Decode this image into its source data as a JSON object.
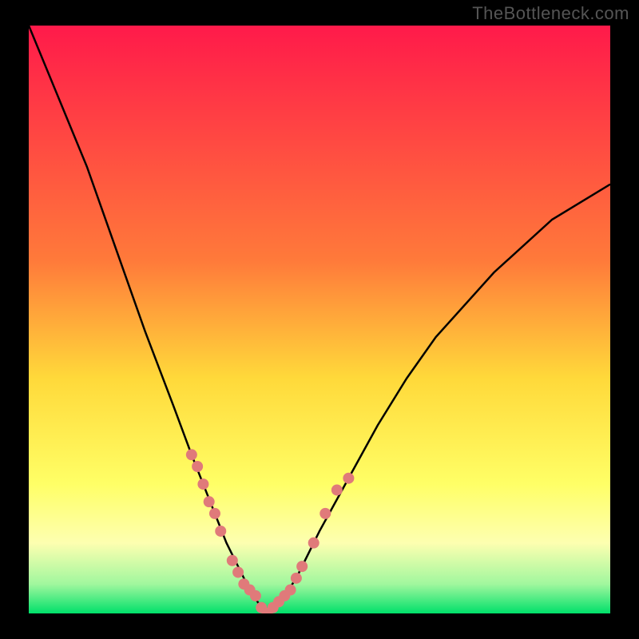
{
  "watermark": "TheBottleneck.com",
  "chart_data": {
    "type": "line",
    "title": "",
    "xlabel": "",
    "ylabel": "",
    "xlim": [
      0,
      100
    ],
    "ylim": [
      0,
      100
    ],
    "bottleneck_x": 41,
    "series": [
      {
        "name": "bottleneck-curve",
        "x": [
          0,
          5,
          10,
          15,
          20,
          25,
          28,
          30,
          32,
          34,
          36,
          38,
          40,
          41,
          42,
          44,
          46,
          48,
          50,
          55,
          60,
          65,
          70,
          80,
          90,
          100
        ],
        "y": [
          100,
          88,
          76,
          62,
          48,
          35,
          27,
          22,
          17,
          12,
          8,
          4,
          1,
          0,
          1,
          3,
          6,
          10,
          14,
          23,
          32,
          40,
          47,
          58,
          67,
          73
        ]
      }
    ],
    "markers": {
      "name": "data-points",
      "x": [
        28,
        29,
        30,
        31,
        32,
        33,
        35,
        36,
        37,
        38,
        39,
        40,
        41,
        42,
        43,
        44,
        45,
        46,
        47,
        49,
        51,
        53,
        55
      ],
      "y": [
        27,
        25,
        22,
        19,
        17,
        14,
        9,
        7,
        5,
        4,
        3,
        1,
        0,
        1,
        2,
        3,
        4,
        6,
        8,
        12,
        17,
        21,
        23
      ]
    },
    "background_gradient": {
      "stops": [
        {
          "offset": 0,
          "color": "#ff1a4a"
        },
        {
          "offset": 40,
          "color": "#ff7a3a"
        },
        {
          "offset": 60,
          "color": "#ffd93a"
        },
        {
          "offset": 78,
          "color": "#ffff66"
        },
        {
          "offset": 88,
          "color": "#fdffb0"
        },
        {
          "offset": 95,
          "color": "#a1f79e"
        },
        {
          "offset": 100,
          "color": "#00e06a"
        }
      ]
    },
    "marker_color": "#e07a7a",
    "curve_color": "#000000"
  }
}
